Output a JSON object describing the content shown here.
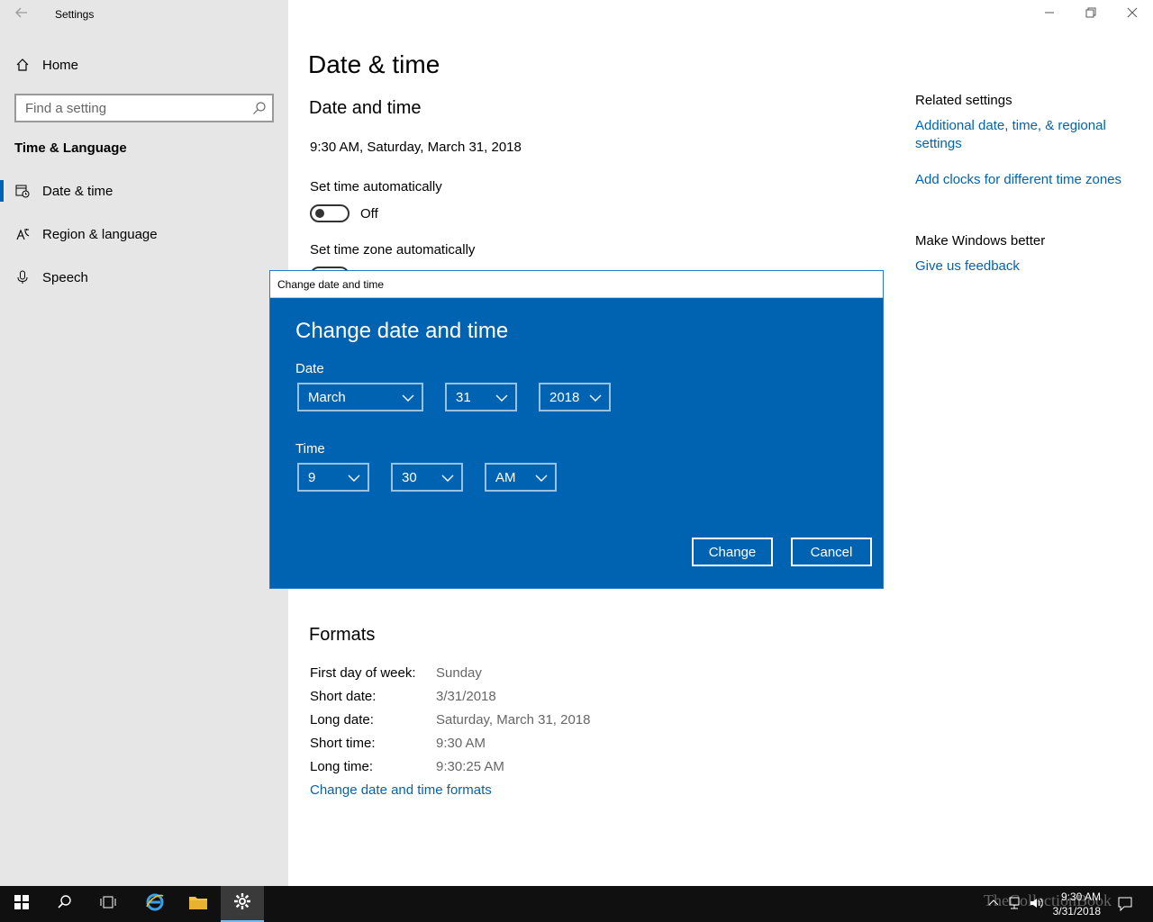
{
  "window": {
    "title": "Settings",
    "controls": [
      "minimize-icon",
      "restore-icon",
      "close-icon"
    ]
  },
  "sidebar": {
    "home_label": "Home",
    "search_placeholder": "Find a setting",
    "section": "Time & Language",
    "items": [
      {
        "label": "Date & time",
        "icon": "calendar-clock-icon",
        "selected": true
      },
      {
        "label": "Region & language",
        "icon": "region-language-icon",
        "selected": false
      },
      {
        "label": "Speech",
        "icon": "microphone-icon",
        "selected": false
      }
    ]
  },
  "main": {
    "page_title": "Date & time",
    "section_title": "Date and time",
    "current_datetime": "9:30 AM, Saturday, March 31, 2018",
    "set_time_auto": {
      "label": "Set time automatically",
      "state": "Off"
    },
    "set_tz_auto": {
      "label": "Set time zone automatically"
    },
    "formats": {
      "title": "Formats",
      "rows": [
        {
          "key": "First day of week:",
          "value": "Sunday"
        },
        {
          "key": "Short date:",
          "value": "3/31/2018"
        },
        {
          "key": "Long date:",
          "value": "Saturday, March 31, 2018"
        },
        {
          "key": "Short time:",
          "value": "9:30 AM"
        },
        {
          "key": "Long time:",
          "value": "9:30:25 AM"
        }
      ],
      "link": "Change date and time formats"
    }
  },
  "related": {
    "heading": "Related settings",
    "link1": "Additional date, time, & regional settings",
    "link2": "Add clocks for different time zones",
    "better_heading": "Make Windows better",
    "feedback": "Give us feedback"
  },
  "dialog": {
    "bar_title": "Change date and time",
    "title": "Change date and time",
    "date_label": "Date",
    "month": "March",
    "day": "31",
    "year": "2018",
    "time_label": "Time",
    "hour": "9",
    "minute": "30",
    "ampm": "AM",
    "change_label": "Change",
    "cancel_label": "Cancel"
  },
  "taskbar": {
    "time": "9:30 AM",
    "date": "3/31/2018",
    "watermark": "TheCollectionBook"
  },
  "colors": {
    "accent": "#0063b1",
    "sidebar_bg": "#e6e6e6",
    "taskbar_bg": "#101010"
  }
}
